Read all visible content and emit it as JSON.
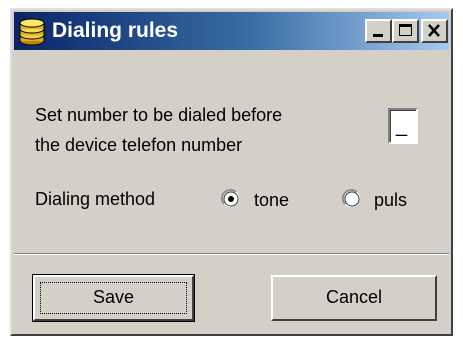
{
  "window": {
    "title": "Dialing rules",
    "icon": "stacked-coins-icon",
    "controls": [
      "minimize-icon",
      "maximize-icon",
      "close-icon"
    ]
  },
  "form": {
    "prefix_label_line1": "Set number to be dialed  before",
    "prefix_label_line2": "the  device telefon number",
    "prefix_value": "_",
    "method_label": "Dialing method",
    "options": [
      {
        "label": "tone",
        "selected": true
      },
      {
        "label": "puls",
        "selected": false
      }
    ]
  },
  "buttons": {
    "save_label": "Save",
    "cancel_label": "Cancel"
  },
  "colors": {
    "titlebar_start": "#0a246a",
    "titlebar_end": "#a6caf0",
    "face": "#d4d0c8"
  }
}
